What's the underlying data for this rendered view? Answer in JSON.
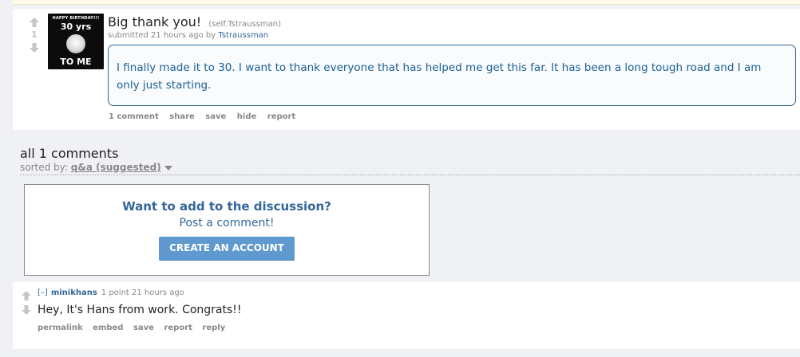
{
  "post": {
    "score": "1",
    "thumbnail": {
      "line1": "HAPPY BIRTHDAY!!!",
      "line2": "30 yrs",
      "line3": "TO ME"
    },
    "title": "Big thank you!",
    "domain": "(self.Tstraussman)",
    "submitted_prefix": "submitted 21 hours ago by",
    "author": "Tstraussman",
    "selftext": "I finally made it to 30. I want to thank everyone that has helped me get this far. It has been a long tough road and I am only just starting.",
    "buttons": {
      "comments": "1 comment",
      "share": "share",
      "save": "save",
      "hide": "hide",
      "report": "report"
    }
  },
  "comments_area": {
    "title": "all 1 comments",
    "sorted_label": "sorted by:",
    "sorted_value": "q&a (suggested)"
  },
  "cta": {
    "heading": "Want to add to the discussion?",
    "subheading": "Post a comment!",
    "button": "CREATE AN ACCOUNT"
  },
  "comment": {
    "expand": "[–]",
    "author": "minikhans",
    "meta": "1 point 21 hours ago",
    "body": "Hey, It's Hans from work. Congrats!!",
    "buttons": {
      "permalink": "permalink",
      "embed": "embed",
      "save": "save",
      "report": "report",
      "reply": "reply"
    }
  },
  "colors": {
    "link_blue": "#369",
    "button_blue": "#5f99cf",
    "muted_gray": "#888"
  }
}
